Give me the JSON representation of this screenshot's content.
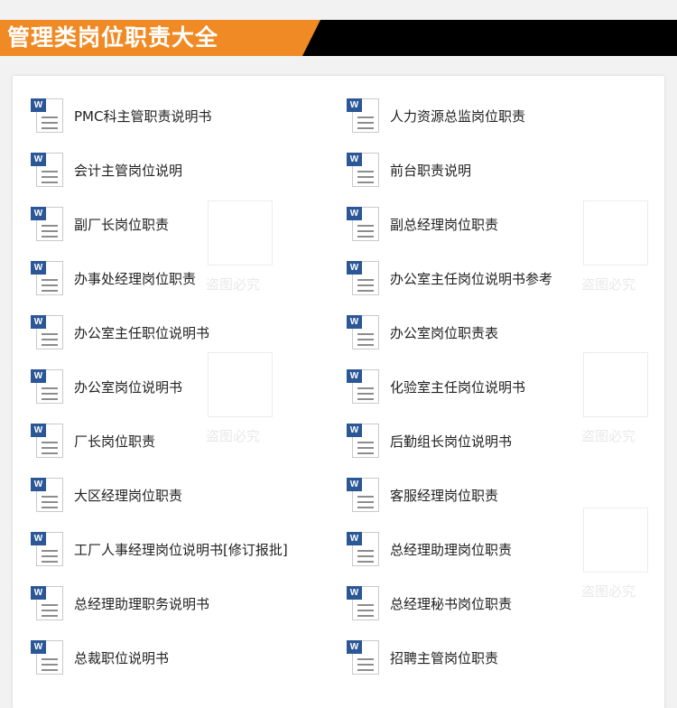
{
  "banner": {
    "title": "管理类岗位职责大全"
  },
  "colors": {
    "accent": "#f08a24",
    "banner_bg": "#000000",
    "icon_blue": "#2b5797"
  },
  "watermark": {
    "text": "盗图必究"
  },
  "files": {
    "left": [
      "PMC科主管职责说明书",
      "会计主管岗位说明",
      "副厂长岗位职责",
      "办事处经理岗位职责",
      "办公室主任职位说明书",
      "办公室岗位说明书",
      "厂长岗位职责",
      "大区经理岗位职责",
      "工厂人事经理岗位说明书[修订报批]",
      "总经理助理职务说明书",
      "总裁职位说明书"
    ],
    "right": [
      "人力资源总监岗位职责",
      "前台职责说明",
      "副总经理岗位职责",
      "办公室主任岗位说明书参考",
      "办公室岗位职责表",
      "化验室主任岗位说明书",
      "后勤组长岗位说明书",
      "客服经理岗位职责",
      "总经理助理岗位职责",
      "总经理秘书岗位职责",
      "招聘主管岗位职责"
    ]
  },
  "icon": {
    "name": "word-document-icon",
    "glyph": "W"
  }
}
